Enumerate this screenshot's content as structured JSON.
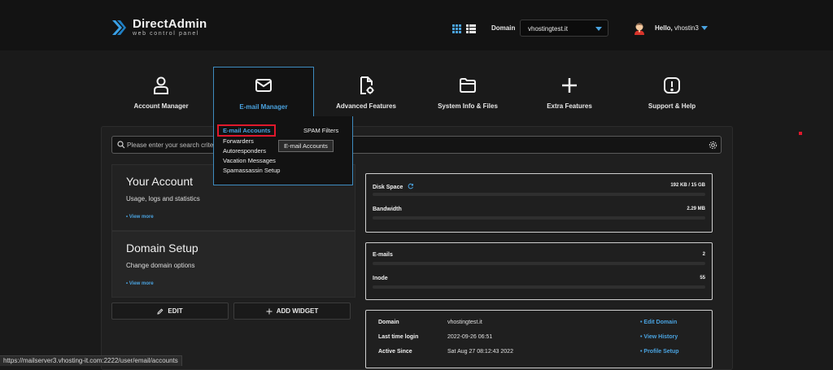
{
  "header": {
    "logo_title": "DirectAdmin",
    "logo_subtitle": "web control panel",
    "domain_label": "Domain",
    "domain_value": "vhostingtest.it",
    "hello_prefix": "Hello,",
    "username": "vhostin3"
  },
  "nav": {
    "items": [
      {
        "label": "Account Manager",
        "icon": "user-icon"
      },
      {
        "label": "E-mail Manager",
        "icon": "envelope-icon",
        "active": true
      },
      {
        "label": "Advanced Features",
        "icon": "file-gear-icon"
      },
      {
        "label": "System Info & Files",
        "icon": "folder-icon"
      },
      {
        "label": "Extra Features",
        "icon": "plus-icon"
      },
      {
        "label": "Support & Help",
        "icon": "alert-icon"
      }
    ]
  },
  "email_menu": {
    "items": [
      "E-mail Accounts",
      "Forwarders",
      "Autoresponders",
      "Vacation Messages",
      "Spamassassin Setup"
    ],
    "side_item": "SPAM Filters",
    "tooltip": "E-mail Accounts"
  },
  "search": {
    "placeholder": "Please enter your search criteria"
  },
  "cards": [
    {
      "title": "Your Account",
      "subtitle": "Usage, logs and statistics",
      "more": "• View more"
    },
    {
      "title": "Domain Setup",
      "subtitle": "Change domain options",
      "more": "• View more"
    }
  ],
  "buttons": {
    "edit": "EDIT",
    "add_widget": "ADD WIDGET"
  },
  "stats": {
    "usage": [
      {
        "name": "Disk Space",
        "value": "192 KB / 15 GB",
        "fill": 0.0
      },
      {
        "name": "Bandwidth",
        "value": "2.29 MB",
        "fill": 0.0
      }
    ],
    "counts": [
      {
        "name": "E-mails",
        "value": "2",
        "fill": 0.0
      },
      {
        "name": "Inode",
        "value": "55",
        "fill": 0.0
      }
    ]
  },
  "info": {
    "rows": [
      {
        "key": "Domain",
        "value": "vhostingtest.it",
        "link": "• Edit Domain"
      },
      {
        "key": "Last time login",
        "value": "2022-09-26 06:51",
        "link": "• View History"
      },
      {
        "key": "Active Since",
        "value": "Sat Aug 27 08:12:43 2022",
        "link": "• Profile Setup"
      }
    ]
  },
  "statusbar": {
    "url": "https://mailserver3.vhosting-it.com:2222/user/email/accounts"
  },
  "colors": {
    "accent": "#4aa3e0",
    "highlight": "#e0182c",
    "background": "#1a1a1a"
  }
}
